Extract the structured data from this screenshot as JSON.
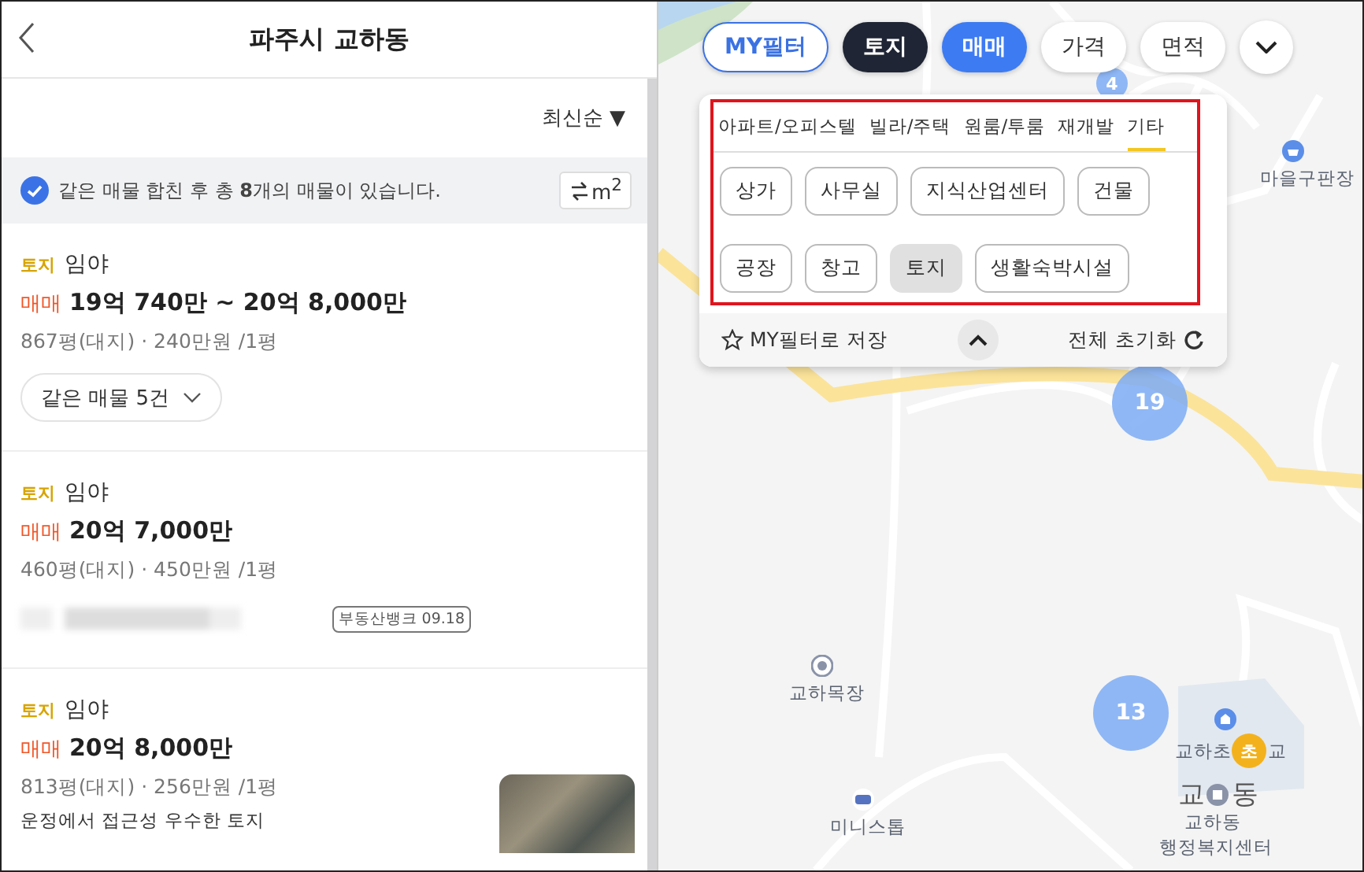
{
  "header": {
    "title": "파주시 교하동"
  },
  "sort": {
    "label": "최신순",
    "arrow": "▼"
  },
  "notice": {
    "checked": true,
    "text": "같은 매물 합친 후 총 **8**개의 매물이 있습니다.",
    "unit_button": "m$^{2}$"
  },
  "listings": [
    {
      "kind": "grouped",
      "category": "토지",
      "subtype": "임야",
      "deal": "매매",
      "price": "19억 740만 ~ 20억 8,000만",
      "area": "867평(대지) · 240만원 /1평",
      "group_button": "같은 매물 5건"
    },
    {
      "kind": "sourced",
      "category": "토지",
      "subtype": "임야",
      "deal": "매매",
      "price": "20억 7,000만",
      "area": "460평(대지) · 450만원 /1평",
      "source_tag": "부동산뱅크 09.18"
    },
    {
      "kind": "photo",
      "category": "토지",
      "subtype": "임야",
      "deal": "매매",
      "price": "20억 8,000만",
      "area": "813평(대지) · 256만원 /1평",
      "description": "운정에서 접근성 우수한 토지"
    }
  ],
  "map": {
    "filter_chips": [
      {
        "label": "MY필터",
        "kind": "outline"
      },
      {
        "label": "토지",
        "kind": "dark"
      },
      {
        "label": "매매",
        "kind": "primary"
      },
      {
        "label": "가격",
        "kind": "plain"
      },
      {
        "label": "면적",
        "kind": "plain"
      }
    ],
    "filter_panel": {
      "tabs": [
        {
          "label": "아파트/오피스텔",
          "selected": false
        },
        {
          "label": "빌라/주택",
          "selected": false
        },
        {
          "label": "원룸/투룸",
          "selected": false
        },
        {
          "label": "재개발",
          "selected": false
        },
        {
          "label": "기타",
          "selected": true
        }
      ],
      "options": [
        {
          "label": "상가",
          "selected": false
        },
        {
          "label": "사무실",
          "selected": false
        },
        {
          "label": "지식산업센터",
          "selected": false
        },
        {
          "label": "건물",
          "selected": false
        },
        {
          "label": "공장",
          "selected": false
        },
        {
          "label": "창고",
          "selected": false
        },
        {
          "label": "토지",
          "selected": true
        },
        {
          "label": "생활숙박시설",
          "selected": false
        }
      ],
      "save_label": "MY필터로 저장",
      "reset_label": "전체 초기화"
    },
    "clusters": [
      {
        "count": "4"
      },
      {
        "count": "19"
      },
      {
        "count": "13"
      }
    ],
    "places": [
      {
        "label": "마을구판장"
      },
      {
        "label": "교하목장"
      },
      {
        "label": "미니스톱"
      }
    ],
    "school": {
      "label_left": "교하초",
      "marker": "초",
      "label_right": "교"
    },
    "district": {
      "left": "교",
      "right": "동",
      "office_line1": "교하동",
      "office_line2": "행정복지센터"
    }
  }
}
